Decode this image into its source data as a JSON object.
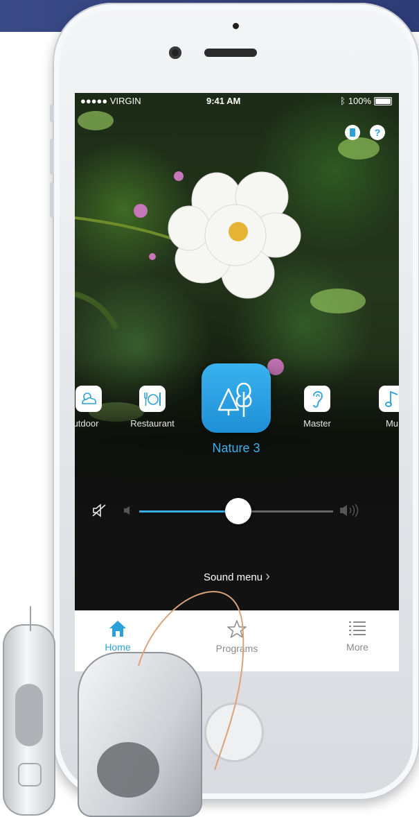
{
  "status_bar": {
    "carrier": "●●●●● VIRGIN",
    "time": "9:41 AM",
    "battery": "100%"
  },
  "top_buttons": {
    "help": "?"
  },
  "programs": [
    {
      "label": "utdoor",
      "icon": "cloud-sun-icon"
    },
    {
      "label": "Restaurant",
      "icon": "restaurant-icon"
    },
    {
      "label": "Nature 3",
      "icon": "trees-icon",
      "selected": true
    },
    {
      "label": "Master",
      "icon": "ear-icon"
    },
    {
      "label": "Mu",
      "icon": "music-note-icon"
    }
  ],
  "volume": {
    "level": 0.51
  },
  "sound_menu": {
    "label": "Sound menu",
    "chevron": "›"
  },
  "tabbar": {
    "home": "Home",
    "programs": "Programs",
    "more": "More"
  },
  "colors": {
    "accent": "#2ba0d8",
    "tab_active": "#2ba0d8",
    "banner": "#33427e"
  }
}
